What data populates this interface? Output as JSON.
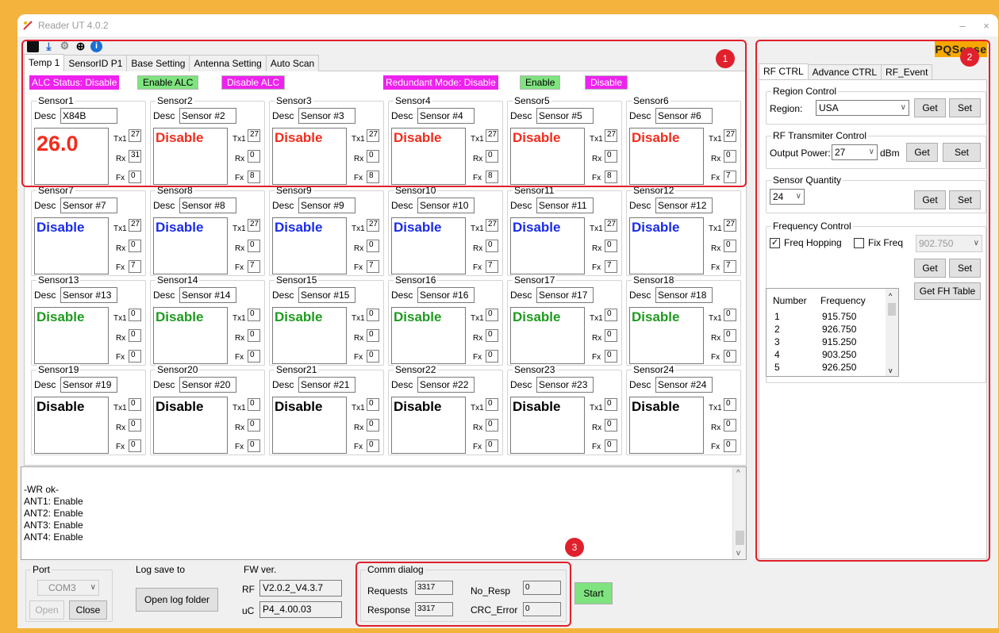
{
  "window": {
    "title": "Reader UT 4.0.2",
    "min_glyph": "–",
    "close_glyph": "×"
  },
  "toolbar": {
    "icons": [
      "stop-icon",
      "download-icon",
      "link-icon",
      "globe-icon",
      "info-icon"
    ]
  },
  "tabs": [
    "Temp 1",
    "SensorID P1",
    "Base Setting",
    "Antenna Setting",
    "Auto Scan"
  ],
  "alc": {
    "status": "ALC Status: Disable",
    "enable": "Enable ALC",
    "disable": "Disable ALC",
    "redundant_status": "Redundant Mode: Disable",
    "redundant_enable": "Enable",
    "redundant_disable": "Disable"
  },
  "labels": {
    "desc": "Desc",
    "tx": "Tx1",
    "rx": "Rx",
    "fx": "Fx"
  },
  "colors": {
    "red": "#f22c1c",
    "blue": "#1a2be8",
    "green": "#1f9a1f",
    "black": "#000000"
  },
  "sensors": [
    {
      "name": "Sensor1",
      "desc": "X84B",
      "value": "26.0",
      "color": "red",
      "big": true,
      "tx": "27",
      "rx": "31",
      "fx": "0"
    },
    {
      "name": "Sensor2",
      "desc": "Sensor #2",
      "value": "Disable",
      "color": "red",
      "tx": "27",
      "rx": "0",
      "fx": "8"
    },
    {
      "name": "Sensor3",
      "desc": "Sensor #3",
      "value": "Disable",
      "color": "red",
      "tx": "27",
      "rx": "0",
      "fx": "8"
    },
    {
      "name": "Sensor4",
      "desc": "Sensor #4",
      "value": "Disable",
      "color": "red",
      "tx": "27",
      "rx": "0",
      "fx": "8"
    },
    {
      "name": "Sensor5",
      "desc": "Sensor #5",
      "value": "Disable",
      "color": "red",
      "tx": "27",
      "rx": "0",
      "fx": "8"
    },
    {
      "name": "Sensor6",
      "desc": "Sensor #6",
      "value": "Disable",
      "color": "red",
      "tx": "27",
      "rx": "0",
      "fx": "7"
    },
    {
      "name": "Sensor7",
      "desc": "Sensor #7",
      "value": "Disable",
      "color": "blue",
      "tx": "27",
      "rx": "0",
      "fx": "7"
    },
    {
      "name": "Sensor8",
      "desc": "Sensor #8",
      "value": "Disable",
      "color": "blue",
      "tx": "27",
      "rx": "0",
      "fx": "7"
    },
    {
      "name": "Sensor9",
      "desc": "Sensor #9",
      "value": "Disable",
      "color": "blue",
      "tx": "27",
      "rx": "0",
      "fx": "7"
    },
    {
      "name": "Sensor10",
      "desc": "Sensor #10",
      "value": "Disable",
      "color": "blue",
      "tx": "27",
      "rx": "0",
      "fx": "7"
    },
    {
      "name": "Sensor11",
      "desc": "Sensor #11",
      "value": "Disable",
      "color": "blue",
      "tx": "27",
      "rx": "0",
      "fx": "7"
    },
    {
      "name": "Sensor12",
      "desc": "Sensor #12",
      "value": "Disable",
      "color": "blue",
      "tx": "27",
      "rx": "0",
      "fx": "7"
    },
    {
      "name": "Sensor13",
      "desc": "Sensor #13",
      "value": "Disable",
      "color": "green",
      "tx": "0",
      "rx": "0",
      "fx": "0"
    },
    {
      "name": "Sensor14",
      "desc": "Sensor #14",
      "value": "Disable",
      "color": "green",
      "tx": "0",
      "rx": "0",
      "fx": "0"
    },
    {
      "name": "Sensor15",
      "desc": "Sensor #15",
      "value": "Disable",
      "color": "green",
      "tx": "0",
      "rx": "0",
      "fx": "0"
    },
    {
      "name": "Sensor16",
      "desc": "Sensor #16",
      "value": "Disable",
      "color": "green",
      "tx": "0",
      "rx": "0",
      "fx": "0"
    },
    {
      "name": "Sensor17",
      "desc": "Sensor #17",
      "value": "Disable",
      "color": "green",
      "tx": "0",
      "rx": "0",
      "fx": "0"
    },
    {
      "name": "Sensor18",
      "desc": "Sensor #18",
      "value": "Disable",
      "color": "green",
      "tx": "0",
      "rx": "0",
      "fx": "0"
    },
    {
      "name": "Sensor19",
      "desc": "Sensor #19",
      "value": "Disable",
      "color": "black",
      "tx": "0",
      "rx": "0",
      "fx": "0"
    },
    {
      "name": "Sensor20",
      "desc": "Sensor #20",
      "value": "Disable",
      "color": "black",
      "tx": "0",
      "rx": "0",
      "fx": "0"
    },
    {
      "name": "Sensor21",
      "desc": "Sensor #21",
      "value": "Disable",
      "color": "black",
      "tx": "0",
      "rx": "0",
      "fx": "0"
    },
    {
      "name": "Sensor22",
      "desc": "Sensor #22",
      "value": "Disable",
      "color": "black",
      "tx": "0",
      "rx": "0",
      "fx": "0"
    },
    {
      "name": "Sensor23",
      "desc": "Sensor #23",
      "value": "Disable",
      "color": "black",
      "tx": "0",
      "rx": "0",
      "fx": "0"
    },
    {
      "name": "Sensor24",
      "desc": "Sensor #24",
      "value": "Disable",
      "color": "black",
      "tx": "0",
      "rx": "0",
      "fx": "0"
    }
  ],
  "log": {
    "lines": [
      "-WR ok-",
      "ANT1: Enable",
      "ANT2: Enable",
      "ANT3: Enable",
      "ANT4: Enable"
    ]
  },
  "port": {
    "legend": "Port",
    "value": "COM3",
    "open": "Open",
    "close": "Close"
  },
  "logsave": {
    "legend": "Log save to",
    "button": "Open log folder"
  },
  "fw": {
    "legend": "FW ver.",
    "rf_label": "RF",
    "rf_value": "V2.0.2_V4.3.7",
    "uc_label": "uC",
    "uc_value": "P4_4.00.03"
  },
  "comm": {
    "legend": "Comm dialog",
    "requests_label": "Requests",
    "requests": "3317",
    "response_label": "Response",
    "response": "3317",
    "noresp_label": "No_Resp",
    "noresp": "0",
    "crc_label": "CRC_Error",
    "crc": "0",
    "start": "Start"
  },
  "right": {
    "logo": "PQSense",
    "tabs": [
      "RF CTRL",
      "Advance CTRL",
      "RF_Event"
    ],
    "get": "Get",
    "set": "Set",
    "region": {
      "legend": "Region Control",
      "label": "Region:",
      "value": "USA"
    },
    "rftx": {
      "legend": "RF Transmiter Control",
      "label": "Output Power:",
      "value": "27",
      "unit": "dBm"
    },
    "quantity": {
      "legend": "Sensor Quantity",
      "value": "24"
    },
    "freq": {
      "legend": "Frequency Control",
      "hopping_label": "Freq Hopping",
      "hopping_checked": true,
      "fix_label": "Fix Freq",
      "fix_checked": false,
      "fix_value": "902.750",
      "fh_button": "Get FH Table",
      "col_number": "Number",
      "col_freq": "Frequency",
      "rows": [
        {
          "n": "1",
          "f": "915.750"
        },
        {
          "n": "2",
          "f": "926.750"
        },
        {
          "n": "3",
          "f": "915.250"
        },
        {
          "n": "4",
          "f": "903.250"
        },
        {
          "n": "5",
          "f": "926.250"
        }
      ]
    }
  },
  "annotations": [
    "1",
    "2",
    "3"
  ]
}
